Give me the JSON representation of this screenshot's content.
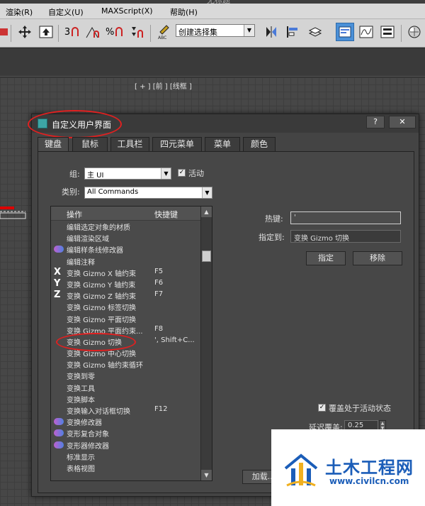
{
  "window_title": "无标题",
  "menubar": [
    "渲染(R)",
    "自定义(U)",
    "MAXScript(X)",
    "帮助(H)"
  ],
  "toolbar": {
    "selection_set_placeholder": "创建选择集",
    "snap_labels": [
      "3",
      "%"
    ],
    "selected_tool": "layer-explorer"
  },
  "viewport": {
    "label": "[ + ] [前 ] [线框 ]"
  },
  "dialog": {
    "title": "自定义用户界面",
    "help_button": "?",
    "close_button": "✕",
    "tabs": [
      "键盘",
      "鼠标",
      "工具栏",
      "四元菜单",
      "菜单",
      "颜色"
    ],
    "active_tab": "键盘",
    "group_label": "组:",
    "group_value": "主 UI",
    "active_label": "活动",
    "active_checked": true,
    "category_label": "类别:",
    "category_value": "All Commands",
    "list": {
      "header_action": "操作",
      "header_shortcut": "快捷键",
      "rows": [
        {
          "icon": "",
          "action": "编辑选定对象的材质",
          "shortcut": ""
        },
        {
          "icon": "",
          "action": "编辑渲染区域",
          "shortcut": ""
        },
        {
          "icon": "spline-icon",
          "action": "编辑样条线修改器",
          "shortcut": ""
        },
        {
          "icon": "",
          "action": "编辑注释",
          "shortcut": ""
        },
        {
          "icon": "X",
          "action": "变换 Gizmo X 轴约束",
          "shortcut": "F5"
        },
        {
          "icon": "Y",
          "action": "变换 Gizmo Y 轴约束",
          "shortcut": "F6"
        },
        {
          "icon": "Z",
          "action": "变换 Gizmo Z 轴约束",
          "shortcut": "F7"
        },
        {
          "icon": "",
          "action": "变换 Gizmo 标签切换",
          "shortcut": ""
        },
        {
          "icon": "",
          "action": "变换 Gizmo 平面切换",
          "shortcut": ""
        },
        {
          "icon": "",
          "action": "变换 Gizmo 平面约束...",
          "shortcut": "F8"
        },
        {
          "icon": "",
          "action": "变换 Gizmo 切换",
          "shortcut": "', Shift+C..."
        },
        {
          "icon": "",
          "action": "变换 Gizmo 中心切换",
          "shortcut": ""
        },
        {
          "icon": "",
          "action": "变换 Gizmo 轴约束循环",
          "shortcut": ""
        },
        {
          "icon": "",
          "action": "变换到零",
          "shortcut": ""
        },
        {
          "icon": "",
          "action": "变换工具",
          "shortcut": ""
        },
        {
          "icon": "",
          "action": "变换脚本",
          "shortcut": ""
        },
        {
          "icon": "",
          "action": "变换输入对话框切换",
          "shortcut": "F12"
        },
        {
          "icon": "modifier-icon",
          "action": "变换修改器",
          "shortcut": ""
        },
        {
          "icon": "morph-icon",
          "action": "变形复合对象",
          "shortcut": ""
        },
        {
          "icon": "morph-icon",
          "action": "变形器修改器",
          "shortcut": ""
        },
        {
          "icon": "",
          "action": "标准显示",
          "shortcut": ""
        },
        {
          "icon": "",
          "action": "表格视图",
          "shortcut": ""
        }
      ]
    },
    "hotkey_label": "热键:",
    "hotkey_value": "'",
    "assigned_to_label": "指定到:",
    "assigned_to_value": "变换 Gizmo 切换",
    "assign_button": "指定",
    "remove_button": "移除",
    "override_label": "覆盖处于活动状态",
    "override_checked": true,
    "delay_label": "延迟覆盖:",
    "delay_value": "0.25",
    "load_button": "加载..."
  },
  "watermark": {
    "name": "土木工程网",
    "url": "www.civilcn.com"
  },
  "colors": {
    "annotation": "#e02020",
    "active_tool": "#4a90d8",
    "watermark": "#1b5db8"
  }
}
